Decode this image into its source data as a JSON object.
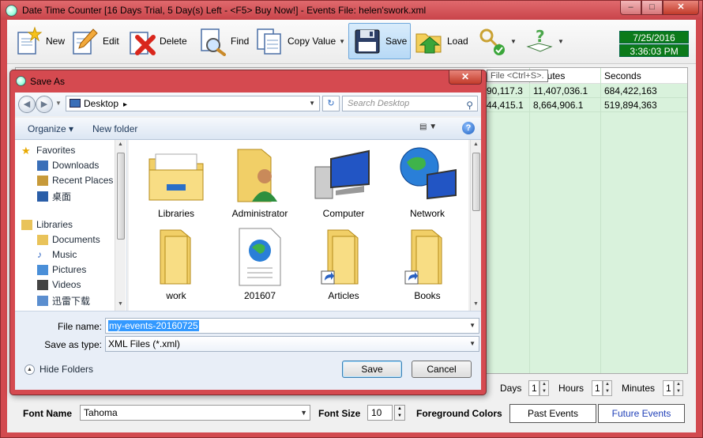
{
  "window": {
    "title": "Date Time Counter [16 Days Trial, 5 Day(s) Left  - <F5> Buy Now!] - Events File: helen'swork.xml",
    "caption": {
      "minimize": "–",
      "maximize": "□",
      "close": "✕"
    }
  },
  "toolbar": {
    "new": "New",
    "edit": "Edit",
    "delete": "Delete",
    "find": "Find",
    "copy_value": "Copy Value",
    "save": "Save",
    "load": "Load",
    "date": "7/25/2016",
    "time": "3:36:03 PM"
  },
  "grid": {
    "headers": [
      "...nutes",
      "Seconds"
    ],
    "rows": [
      [
        "90,117.3",
        "11,407,036.1",
        "684,422,163"
      ],
      [
        "44,415.1",
        "8,664,906.1",
        "519,894,363"
      ]
    ]
  },
  "tooltip": "File <Ctrl+S>.",
  "units": {
    "days": "Days",
    "hours": "Hours",
    "minutes": "Minutes",
    "days_val": "1",
    "hours_val": "1",
    "minutes_val": "1"
  },
  "bottom": {
    "font_name_label": "Font Name",
    "font_name_value": "Tahoma",
    "font_size_label": "Font Size",
    "font_size_value": "10",
    "fg_colors_label": "Foreground Colors",
    "past_events": "Past Events",
    "future_events": "Future Events"
  },
  "dialog": {
    "title": "Save As",
    "close": "✕",
    "address": "Desktop",
    "search_placeholder": "Search Desktop",
    "organize": "Organize ▾",
    "new_folder": "New folder",
    "nav": {
      "favorites": "Favorites",
      "downloads": "Downloads",
      "recent_places": "Recent Places",
      "desktop_cn": "桌面",
      "libraries": "Libraries",
      "documents": "Documents",
      "music": "Music",
      "pictures": "Pictures",
      "videos": "Videos",
      "xunlei": "迅雷下载"
    },
    "files": [
      "Libraries",
      "Administrator",
      "Computer",
      "Network",
      "work",
      "201607",
      "Articles",
      "Books"
    ],
    "file_name_label": "File name:",
    "file_name_value": "my-events-20160725",
    "save_as_type_label": "Save as type:",
    "save_as_type_value": "XML Files (*.xml)",
    "hide_folders": "Hide Folders",
    "save_btn": "Save",
    "cancel_btn": "Cancel"
  }
}
